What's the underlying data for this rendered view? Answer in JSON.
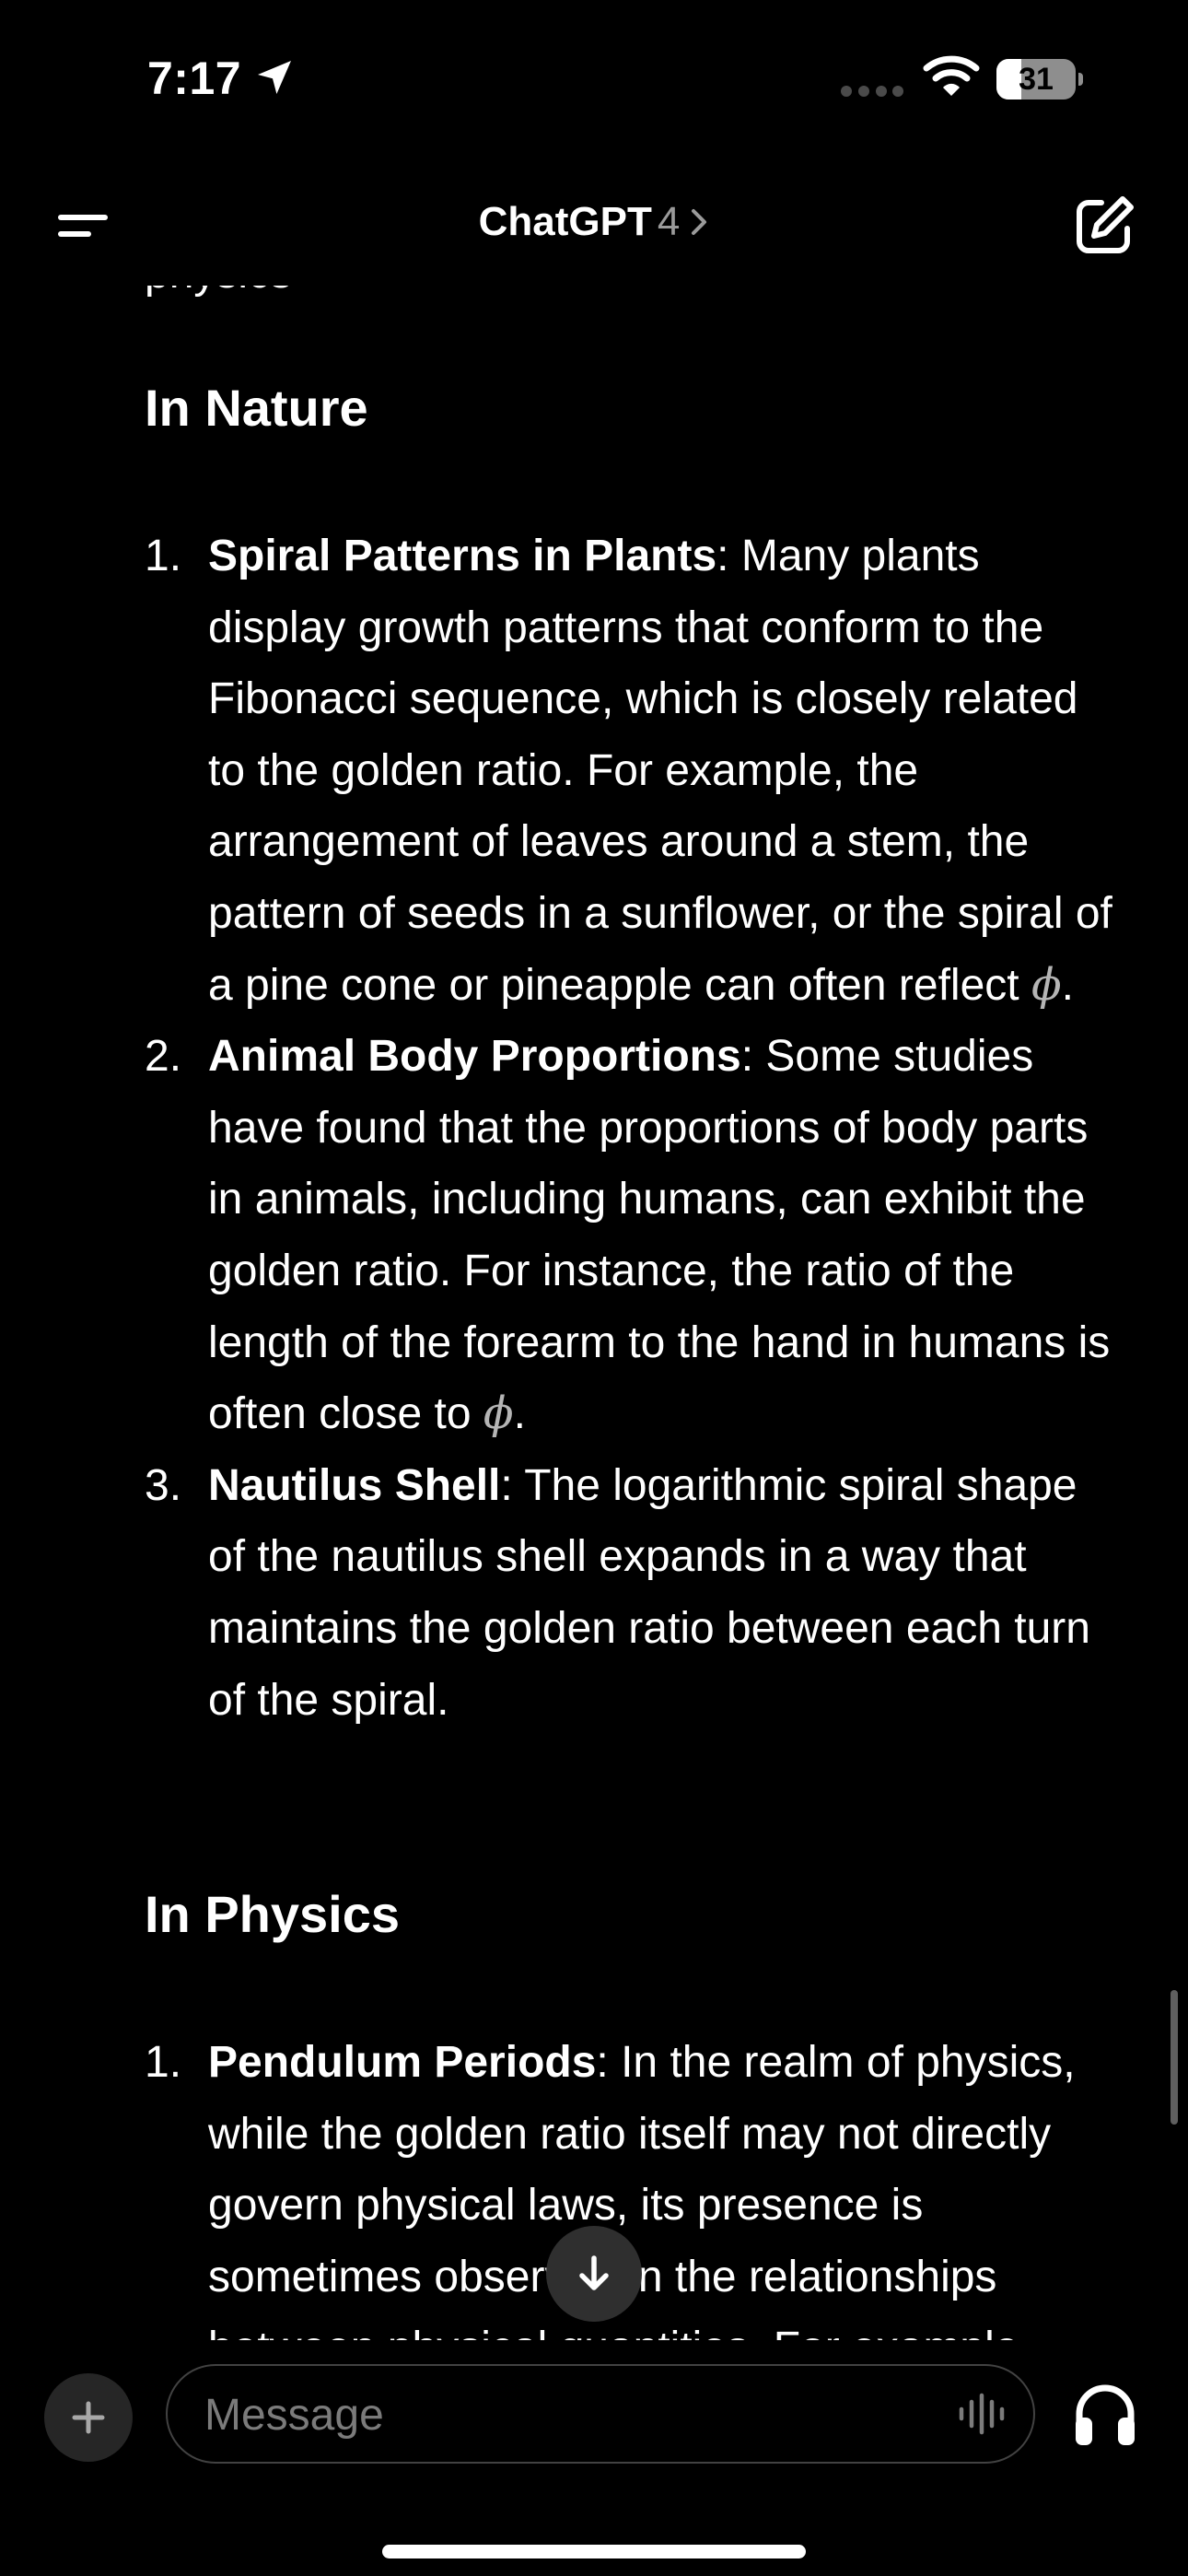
{
  "status_bar": {
    "time": "7:17",
    "battery_level": "31",
    "battery_fraction": 0.31,
    "icons": [
      "location-arrow-icon",
      "cellular-dots-icon",
      "wifi-icon",
      "battery-icon"
    ]
  },
  "nav": {
    "title": "ChatGPT",
    "model": "4",
    "icons": [
      "menu-icon",
      "chevron-right-icon",
      "compose-icon"
    ]
  },
  "content": {
    "cutoff_text": "physics",
    "sections": [
      {
        "heading": "In Nature",
        "items": [
          {
            "number": "1.",
            "title": "Spiral Patterns in Plants",
            "text": ": Many plants display growth patterns that conform to the Fibonacci sequence, which is closely related to the golden ratio. For example, the arrangement of leaves around a stem, the pattern of seeds in a sunflower, or the spiral of a pine cone or pineapple can often reflect ",
            "symbol": "ϕ",
            "end": "."
          },
          {
            "number": "2.",
            "title": "Animal Body Proportions",
            "text": ": Some studies have found that the proportions of body parts in animals, including humans, can exhibit the golden ratio. For instance, the ratio of the length of the forearm to the hand in humans is often close to ",
            "symbol": "ϕ",
            "end": "."
          },
          {
            "number": "3.",
            "title": "Nautilus Shell",
            "text": ": The logarithmic spiral shape of the nautilus shell expands in a way that maintains the golden ratio between each turn of the spiral.",
            "symbol": "",
            "end": ""
          }
        ]
      },
      {
        "heading": "In Physics",
        "items": [
          {
            "number": "1.",
            "title": "Pendulum Periods",
            "text": ": In the realm of physics, while the golden ratio itself may not directly govern physical laws, its presence is sometimes observed in the relationships between physical quantities. For example",
            "symbol": "",
            "end": ""
          }
        ]
      }
    ]
  },
  "scroll_down_icon": "arrow-down-icon",
  "composer": {
    "placeholder": "Message",
    "icons": [
      "plus-icon",
      "voice-waveform-icon",
      "headphones-icon"
    ]
  }
}
